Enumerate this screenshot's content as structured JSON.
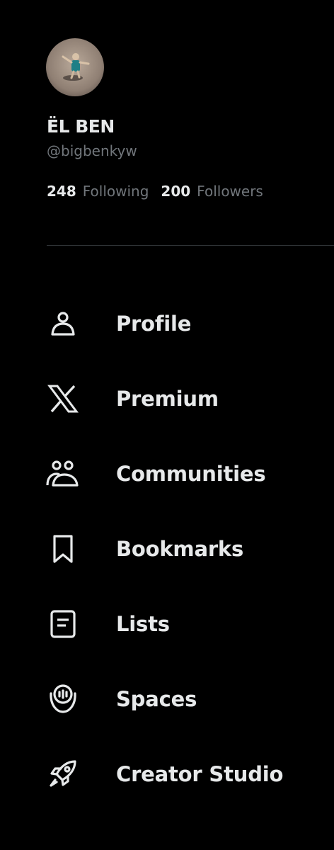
{
  "profile": {
    "display_name": "ËL BEN",
    "handle": "@bigbenkyw",
    "following_count": "248",
    "following_label": "Following",
    "followers_count": "200",
    "followers_label": "Followers"
  },
  "nav": {
    "items": [
      {
        "label": "Profile",
        "icon": "person-icon"
      },
      {
        "label": "Premium",
        "icon": "x-logo-icon"
      },
      {
        "label": "Communities",
        "icon": "communities-icon"
      },
      {
        "label": "Bookmarks",
        "icon": "bookmark-icon"
      },
      {
        "label": "Lists",
        "icon": "list-icon"
      },
      {
        "label": "Spaces",
        "icon": "spaces-icon"
      },
      {
        "label": "Creator Studio",
        "icon": "rocket-icon"
      }
    ]
  },
  "colors": {
    "background": "#000000",
    "primary_text": "#e7e9ea",
    "secondary_text": "#71767b",
    "divider": "#2f3336"
  }
}
